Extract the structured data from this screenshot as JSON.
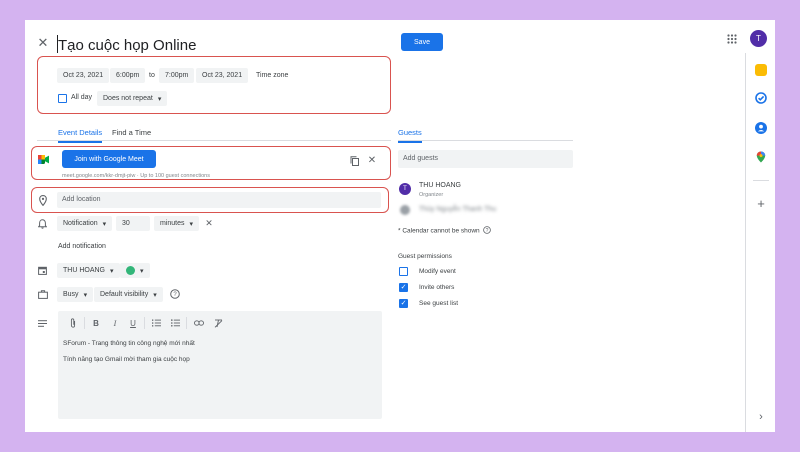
{
  "header": {
    "title": "Tạo cuộc họp Online",
    "save_label": "Save",
    "avatar_letter": "T"
  },
  "datetime": {
    "start_date": "Oct 23, 2021",
    "start_time": "6:00pm",
    "to_label": "to",
    "end_time": "7:00pm",
    "end_date": "Oct 23, 2021",
    "timezone_label": "Time zone",
    "all_day_label": "All day",
    "repeat_value": "Does not repeat"
  },
  "tabs": {
    "event_details": "Event Details",
    "find_time": "Find a Time",
    "guests": "Guests"
  },
  "meet": {
    "button_label": "Join with Google Meet",
    "link_text": "meet.google.com/kkr-dmjt-piw · Up to 100 guest connections"
  },
  "location": {
    "placeholder": "Add location"
  },
  "notification": {
    "type": "Notification",
    "value": "30",
    "unit": "minutes",
    "add_label": "Add notification"
  },
  "calendar": {
    "owner": "THU HOANG",
    "color": "#33b679"
  },
  "availability": {
    "status": "Busy",
    "visibility": "Default visibility"
  },
  "description": {
    "line1": "SForum - Trang thông tin công nghệ mới nhất",
    "line2": "Tính năng tạo Gmail mời tham gia cuộc họp"
  },
  "guests": {
    "add_placeholder": "Add guests",
    "organizer_name": "THU HOANG",
    "organizer_role": "Organizer",
    "organizer_letter": "T",
    "second_guest_blurred": "Thùy Nguyễn Thanh Thu",
    "calendar_note": "* Calendar cannot be shown",
    "permissions_title": "Guest permissions",
    "permissions": [
      {
        "label": "Modify event",
        "checked": false
      },
      {
        "label": "Invite others",
        "checked": true
      },
      {
        "label": "See guest list",
        "checked": true
      }
    ]
  },
  "colors": {
    "primary": "#1a73e8",
    "highlight": "#d9534f",
    "background": "#d4b3f0",
    "avatar": "#512da8"
  }
}
